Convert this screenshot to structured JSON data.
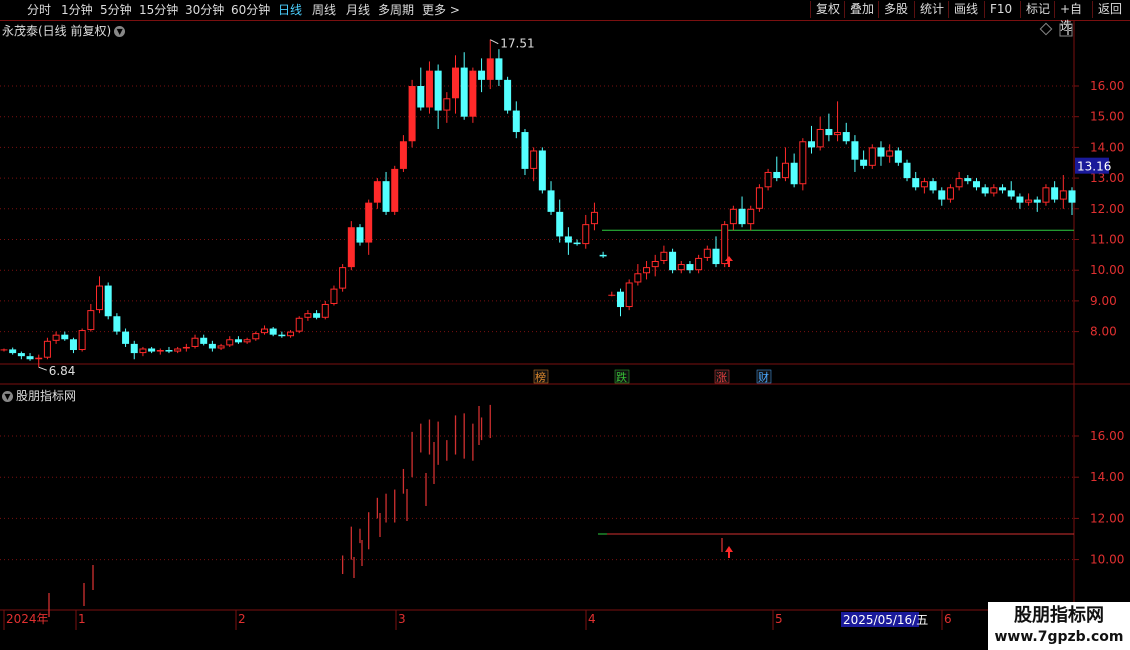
{
  "toolbar": {
    "timeframes": [
      "分时",
      "1分钟",
      "5分钟",
      "15分钟",
      "30分钟",
      "60分钟",
      "日线",
      "周线",
      "月线",
      "多周期",
      "更多 >"
    ],
    "active_timeframe": "日线",
    "right_buttons": [
      "复权",
      "叠加",
      "多股",
      "统计",
      "画线",
      "F10",
      "标记",
      "+自选",
      "返回"
    ]
  },
  "chart": {
    "title": "永茂泰(日线 前复权)",
    "high_label": "17.51",
    "low_label": "6.84",
    "current_price": "13.16",
    "event_tags": [
      {
        "text": "榜",
        "color": "#e08a2c"
      },
      {
        "text": "跌",
        "color": "#35c035"
      },
      {
        "text": "涨",
        "color": "#e84040"
      },
      {
        "text": "财",
        "color": "#4ba8ff"
      }
    ]
  },
  "indicator": {
    "title": "股朋指标网"
  },
  "time_axis": {
    "labels": [
      "2024年",
      "1",
      "2",
      "3",
      "4",
      "5",
      "6"
    ],
    "cursor_date": "2025/05/16/五"
  },
  "watermark": {
    "title": "股朋指标网",
    "url": "www.7gpzb.com"
  },
  "colors": {
    "up": "#ff2a2a",
    "down": "#54ffff",
    "grid": "#7a1010",
    "support_line": "#2ecc40",
    "highlight_badge": "#1a1a9a"
  },
  "chart_data": {
    "type": "candlestick",
    "title": "永茂泰(日线 前复权)",
    "y_ticks_main": [
      8.0,
      9.0,
      10.0,
      11.0,
      12.0,
      13.0,
      14.0,
      15.0,
      16.0
    ],
    "y_ticks_sub": [
      10.0,
      12.0,
      14.0,
      16.0
    ],
    "support_level": 11.3,
    "ohlc": [
      [
        7.4,
        7.45,
        7.35,
        7.42
      ],
      [
        7.42,
        7.48,
        7.25,
        7.3
      ],
      [
        7.3,
        7.35,
        7.1,
        7.2
      ],
      [
        7.2,
        7.3,
        7.05,
        7.1
      ],
      [
        7.1,
        7.25,
        6.84,
        7.15
      ],
      [
        7.15,
        7.8,
        7.1,
        7.7
      ],
      [
        7.7,
        8.0,
        7.6,
        7.9
      ],
      [
        7.9,
        8.0,
        7.7,
        7.75
      ],
      [
        7.75,
        7.8,
        7.3,
        7.4
      ],
      [
        7.4,
        8.1,
        7.35,
        8.05
      ],
      [
        8.05,
        8.9,
        8.0,
        8.7
      ],
      [
        8.7,
        9.8,
        8.6,
        9.5
      ],
      [
        9.5,
        9.6,
        8.4,
        8.5
      ],
      [
        8.5,
        8.6,
        7.9,
        8.0
      ],
      [
        8.0,
        8.1,
        7.5,
        7.6
      ],
      [
        7.6,
        7.7,
        7.1,
        7.3
      ],
      [
        7.3,
        7.5,
        7.2,
        7.45
      ],
      [
        7.45,
        7.5,
        7.3,
        7.35
      ],
      [
        7.35,
        7.45,
        7.25,
        7.4
      ],
      [
        7.4,
        7.5,
        7.3,
        7.35
      ],
      [
        7.35,
        7.5,
        7.3,
        7.45
      ],
      [
        7.45,
        7.6,
        7.35,
        7.5
      ],
      [
        7.5,
        7.9,
        7.45,
        7.8
      ],
      [
        7.8,
        7.9,
        7.55,
        7.6
      ],
      [
        7.6,
        7.7,
        7.35,
        7.45
      ],
      [
        7.45,
        7.6,
        7.4,
        7.55
      ],
      [
        7.55,
        7.85,
        7.5,
        7.75
      ],
      [
        7.75,
        7.85,
        7.6,
        7.65
      ],
      [
        7.65,
        7.8,
        7.6,
        7.75
      ],
      [
        7.75,
        8.0,
        7.7,
        7.95
      ],
      [
        7.95,
        8.2,
        7.9,
        8.1
      ],
      [
        8.1,
        8.15,
        7.85,
        7.9
      ],
      [
        7.9,
        8.0,
        7.8,
        7.85
      ],
      [
        7.85,
        8.05,
        7.8,
        8.0
      ],
      [
        8.0,
        8.5,
        7.95,
        8.45
      ],
      [
        8.45,
        8.7,
        8.35,
        8.6
      ],
      [
        8.6,
        8.7,
        8.4,
        8.45
      ],
      [
        8.45,
        9.0,
        8.4,
        8.9
      ],
      [
        8.9,
        9.5,
        8.85,
        9.4
      ],
      [
        9.4,
        10.2,
        9.3,
        10.1
      ],
      [
        10.1,
        11.6,
        10.0,
        11.4
      ],
      [
        11.4,
        11.5,
        10.8,
        10.9
      ],
      [
        10.9,
        12.3,
        10.5,
        12.2
      ],
      [
        12.2,
        13.0,
        12.0,
        12.9
      ],
      [
        12.9,
        13.2,
        11.8,
        11.9
      ],
      [
        11.9,
        13.4,
        11.8,
        13.3
      ],
      [
        13.3,
        14.4,
        13.2,
        14.2
      ],
      [
        14.2,
        16.2,
        14.0,
        16.0
      ],
      [
        16.0,
        16.6,
        15.2,
        15.3
      ],
      [
        15.3,
        16.8,
        15.1,
        16.5
      ],
      [
        16.5,
        16.7,
        14.6,
        15.2
      ],
      [
        15.2,
        15.8,
        14.8,
        15.6
      ],
      [
        15.6,
        17.0,
        15.1,
        16.6
      ],
      [
        16.6,
        17.1,
        14.9,
        15.0
      ],
      [
        15.0,
        16.6,
        14.8,
        16.5
      ],
      [
        16.5,
        16.9,
        15.8,
        16.2
      ],
      [
        16.2,
        17.51,
        15.9,
        16.9
      ],
      [
        16.9,
        17.2,
        16.0,
        16.2
      ],
      [
        16.2,
        16.3,
        15.1,
        15.2
      ],
      [
        15.2,
        15.5,
        14.3,
        14.5
      ],
      [
        14.5,
        14.6,
        13.1,
        13.3
      ],
      [
        13.3,
        14.0,
        12.9,
        13.9
      ],
      [
        13.9,
        14.0,
        12.5,
        12.6
      ],
      [
        12.6,
        12.9,
        11.8,
        11.9
      ],
      [
        11.9,
        12.3,
        10.9,
        11.1
      ],
      [
        11.1,
        11.4,
        10.5,
        10.9
      ],
      [
        10.9,
        11.0,
        10.8,
        10.85
      ],
      [
        10.85,
        11.8,
        10.7,
        11.5
      ],
      [
        11.5,
        12.2,
        11.3,
        11.9
      ],
      [
        10.5,
        10.6,
        10.4,
        10.45
      ],
      [
        9.2,
        9.3,
        9.15,
        9.2
      ],
      [
        9.3,
        9.4,
        8.5,
        8.8
      ],
      [
        8.8,
        9.7,
        8.7,
        9.6
      ],
      [
        9.6,
        10.2,
        9.5,
        9.9
      ],
      [
        9.9,
        10.3,
        9.7,
        10.1
      ],
      [
        10.1,
        10.5,
        9.8,
        10.3
      ],
      [
        10.3,
        10.8,
        10.2,
        10.6
      ],
      [
        10.6,
        10.7,
        9.9,
        10.0
      ],
      [
        10.0,
        10.3,
        9.9,
        10.2
      ],
      [
        10.2,
        10.3,
        9.9,
        10.0
      ],
      [
        10.0,
        10.5,
        9.9,
        10.4
      ],
      [
        10.4,
        10.8,
        10.3,
        10.7
      ],
      [
        10.7,
        11.1,
        10.1,
        10.2
      ],
      [
        10.2,
        11.6,
        10.1,
        11.5
      ],
      [
        11.5,
        12.1,
        11.3,
        12.0
      ],
      [
        12.0,
        12.4,
        11.4,
        11.5
      ],
      [
        11.5,
        12.1,
        11.3,
        12.0
      ],
      [
        12.0,
        12.8,
        11.9,
        12.7
      ],
      [
        12.7,
        13.3,
        12.6,
        13.2
      ],
      [
        13.2,
        13.7,
        12.9,
        13.0
      ],
      [
        13.0,
        14.0,
        12.9,
        13.5
      ],
      [
        13.5,
        13.8,
        12.7,
        12.8
      ],
      [
        12.8,
        14.3,
        12.6,
        14.2
      ],
      [
        14.2,
        14.7,
        13.8,
        14.0
      ],
      [
        14.0,
        15.0,
        13.9,
        14.6
      ],
      [
        14.6,
        15.1,
        14.2,
        14.4
      ],
      [
        14.4,
        15.5,
        14.2,
        14.5
      ],
      [
        14.5,
        14.8,
        14.1,
        14.2
      ],
      [
        14.2,
        14.4,
        13.2,
        13.6
      ],
      [
        13.6,
        13.9,
        13.3,
        13.4
      ],
      [
        13.4,
        14.1,
        13.3,
        14.0
      ],
      [
        14.0,
        14.2,
        13.4,
        13.7
      ],
      [
        13.7,
        14.1,
        13.5,
        13.9
      ],
      [
        13.9,
        14.0,
        13.4,
        13.5
      ],
      [
        13.5,
        13.6,
        12.9,
        13.0
      ],
      [
        13.0,
        13.2,
        12.6,
        12.7
      ],
      [
        12.7,
        13.0,
        12.5,
        12.9
      ],
      [
        12.9,
        13.0,
        12.5,
        12.6
      ],
      [
        12.6,
        12.7,
        12.1,
        12.3
      ],
      [
        12.3,
        12.8,
        12.2,
        12.7
      ],
      [
        12.7,
        13.2,
        12.6,
        13.0
      ],
      [
        13.0,
        13.1,
        12.8,
        12.9
      ],
      [
        12.9,
        13.0,
        12.6,
        12.7
      ],
      [
        12.7,
        12.8,
        12.4,
        12.5
      ],
      [
        12.5,
        12.8,
        12.4,
        12.7
      ],
      [
        12.7,
        12.8,
        12.5,
        12.6
      ],
      [
        12.6,
        12.9,
        12.3,
        12.4
      ],
      [
        12.4,
        12.5,
        12.0,
        12.2
      ],
      [
        12.2,
        12.5,
        12.1,
        12.3
      ],
      [
        12.3,
        12.4,
        11.9,
        12.2
      ],
      [
        12.2,
        12.8,
        12.1,
        12.7
      ],
      [
        12.7,
        12.9,
        12.2,
        12.3
      ],
      [
        12.3,
        13.1,
        12.0,
        12.6
      ],
      [
        12.6,
        12.7,
        11.8,
        12.2
      ]
    ]
  }
}
